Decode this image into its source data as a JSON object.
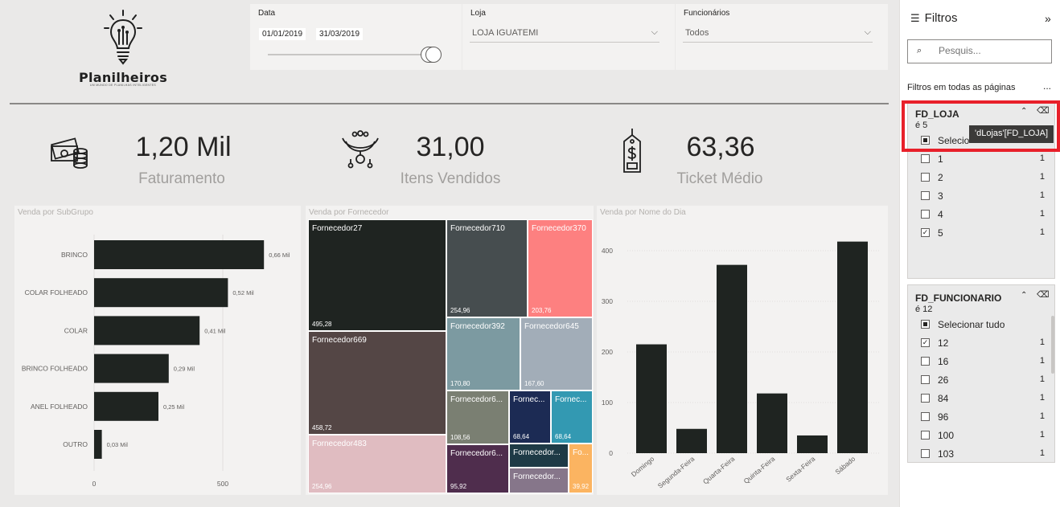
{
  "logo": {
    "name": "Planilheiros",
    "tagline": "UM MUNDO DE PLANILHAS INTELIGENTES"
  },
  "slicers": {
    "date": {
      "title": "Data",
      "start": "01/01/2019",
      "end": "31/03/2019"
    },
    "loja": {
      "title": "Loja",
      "value": "LOJA IGUATEMI"
    },
    "funcionarios": {
      "title": "Funcionários",
      "value": "Todos"
    }
  },
  "kpis": [
    {
      "value": "1,20 Mil",
      "label": "Faturamento",
      "icon": "money-icon"
    },
    {
      "value": "31,00",
      "label": "Itens Vendidos",
      "icon": "jewelry-icon"
    },
    {
      "value": "63,36",
      "label": "Ticket Médio",
      "icon": "price-tag-icon"
    }
  ],
  "chart_data": [
    {
      "type": "bar",
      "title": "Venda por SubGrupo",
      "orientation": "horizontal",
      "categories": [
        "BRINCO",
        "COLAR FOLHEADO",
        "COLAR",
        "BRINCO FOLHEADO",
        "ANEL FOLHEADO",
        "OUTRO"
      ],
      "values": [
        660,
        520,
        410,
        290,
        250,
        30
      ],
      "data_labels": [
        "0,66 Mil",
        "0,52 Mil",
        "0,41 Mil",
        "0,29 Mil",
        "0,25 Mil",
        "0,03 Mil"
      ],
      "x_ticks": [
        "0",
        "500"
      ],
      "xlim": [
        0,
        1000
      ],
      "color": "#1f2421"
    },
    {
      "type": "treemap",
      "title": "Venda por Fornecedor",
      "cells": [
        {
          "name": "Fornecedor27",
          "value": 495.28,
          "label": "495,28",
          "color": "#1f2421"
        },
        {
          "name": "Fornecedor669",
          "value": 458.72,
          "label": "458,72",
          "color": "#544645"
        },
        {
          "name": "Fornecedor483",
          "value": 254.96,
          "label": "254,96",
          "color": "#e0bcc1"
        },
        {
          "name": "Fornecedor710",
          "value": 254.96,
          "label": "254,96",
          "color": "#464d4f"
        },
        {
          "name": "Fornecedor370",
          "value": 203.76,
          "label": "203,76",
          "color": "#fd8080"
        },
        {
          "name": "Fornecedor392",
          "value": 170.8,
          "label": "170,80",
          "color": "#7c9aa1"
        },
        {
          "name": "Fornecedor645",
          "value": 167.6,
          "label": "167,60",
          "color": "#a2adb8"
        },
        {
          "name": "Fornecedor6...",
          "value": 108.56,
          "label": "108,56",
          "color": "#7a7f72"
        },
        {
          "name": "Fornec...",
          "value": 68.64,
          "label": "68,64",
          "color": "#1c2b54"
        },
        {
          "name": "Fornec...",
          "value": 68.64,
          "label": "68,64",
          "color": "#3399b2"
        },
        {
          "name": "Fornecedor6...",
          "value": 95.92,
          "label": "95,92",
          "color": "#4f2d4d"
        },
        {
          "name": "Fornecedor...",
          "value": 0,
          "label": "",
          "color": "#1e3a46"
        },
        {
          "name": "Fornecedor...",
          "value": 0,
          "label": "",
          "color": "#86768a"
        },
        {
          "name": "Fo...",
          "value": 39.92,
          "label": "39,92",
          "color": "#fbb461"
        }
      ]
    },
    {
      "type": "bar",
      "title": "Venda por Nome do Dia",
      "categories": [
        "Domingo",
        "Segunda-Feira",
        "Quarta-Feira",
        "Quinta-Feira",
        "Sexta-Feira",
        "Sábado"
      ],
      "values": [
        215,
        48,
        372,
        118,
        35,
        418
      ],
      "y_ticks": [
        "0",
        "100",
        "200",
        "300",
        "400"
      ],
      "ylim": [
        0,
        450
      ],
      "color": "#1f2421"
    }
  ],
  "filters_pane": {
    "title": "Filtros",
    "search_placeholder": "Pesquis...",
    "section_label": "Filtros em todas as páginas",
    "more": "...",
    "cards": [
      {
        "field": "FD_LOJA",
        "condition": "é 5",
        "items": [
          {
            "label": "Selecionar tudo",
            "count": "",
            "state": "partial"
          },
          {
            "label": "1",
            "count": "1",
            "state": "unchecked"
          },
          {
            "label": "2",
            "count": "1",
            "state": "unchecked"
          },
          {
            "label": "3",
            "count": "1",
            "state": "unchecked"
          },
          {
            "label": "4",
            "count": "1",
            "state": "unchecked"
          },
          {
            "label": "5",
            "count": "1",
            "state": "checked"
          }
        ],
        "visible_select_label": "Selecio"
      },
      {
        "field": "FD_FUNCIONARIO",
        "condition": "é 12",
        "items": [
          {
            "label": "Selecionar tudo",
            "count": "",
            "state": "partial"
          },
          {
            "label": "12",
            "count": "1",
            "state": "checked"
          },
          {
            "label": "16",
            "count": "1",
            "state": "unchecked"
          },
          {
            "label": "26",
            "count": "1",
            "state": "unchecked"
          },
          {
            "label": "84",
            "count": "1",
            "state": "unchecked"
          },
          {
            "label": "96",
            "count": "1",
            "state": "unchecked"
          },
          {
            "label": "100",
            "count": "1",
            "state": "unchecked"
          },
          {
            "label": "103",
            "count": "1",
            "state": "unchecked"
          }
        ]
      }
    ],
    "tooltip": "'dLojas'[FD_LOJA]"
  }
}
